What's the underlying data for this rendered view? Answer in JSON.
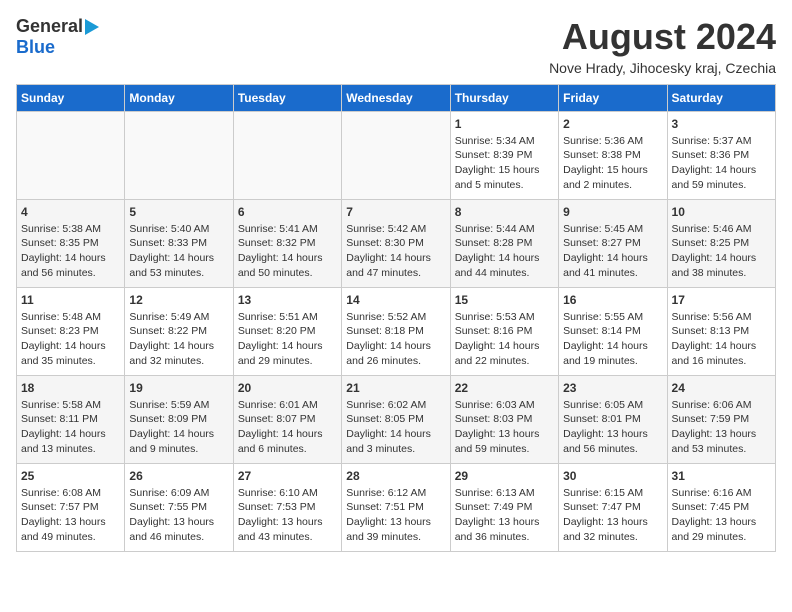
{
  "header": {
    "logo_general": "General",
    "logo_blue": "Blue",
    "month_year": "August 2024",
    "location": "Nove Hrady, Jihocesky kraj, Czechia"
  },
  "days_of_week": [
    "Sunday",
    "Monday",
    "Tuesday",
    "Wednesday",
    "Thursday",
    "Friday",
    "Saturday"
  ],
  "weeks": [
    [
      {
        "day": "",
        "info": ""
      },
      {
        "day": "",
        "info": ""
      },
      {
        "day": "",
        "info": ""
      },
      {
        "day": "",
        "info": ""
      },
      {
        "day": "1",
        "info": "Sunrise: 5:34 AM\nSunset: 8:39 PM\nDaylight: 15 hours\nand 5 minutes."
      },
      {
        "day": "2",
        "info": "Sunrise: 5:36 AM\nSunset: 8:38 PM\nDaylight: 15 hours\nand 2 minutes."
      },
      {
        "day": "3",
        "info": "Sunrise: 5:37 AM\nSunset: 8:36 PM\nDaylight: 14 hours\nand 59 minutes."
      }
    ],
    [
      {
        "day": "4",
        "info": "Sunrise: 5:38 AM\nSunset: 8:35 PM\nDaylight: 14 hours\nand 56 minutes."
      },
      {
        "day": "5",
        "info": "Sunrise: 5:40 AM\nSunset: 8:33 PM\nDaylight: 14 hours\nand 53 minutes."
      },
      {
        "day": "6",
        "info": "Sunrise: 5:41 AM\nSunset: 8:32 PM\nDaylight: 14 hours\nand 50 minutes."
      },
      {
        "day": "7",
        "info": "Sunrise: 5:42 AM\nSunset: 8:30 PM\nDaylight: 14 hours\nand 47 minutes."
      },
      {
        "day": "8",
        "info": "Sunrise: 5:44 AM\nSunset: 8:28 PM\nDaylight: 14 hours\nand 44 minutes."
      },
      {
        "day": "9",
        "info": "Sunrise: 5:45 AM\nSunset: 8:27 PM\nDaylight: 14 hours\nand 41 minutes."
      },
      {
        "day": "10",
        "info": "Sunrise: 5:46 AM\nSunset: 8:25 PM\nDaylight: 14 hours\nand 38 minutes."
      }
    ],
    [
      {
        "day": "11",
        "info": "Sunrise: 5:48 AM\nSunset: 8:23 PM\nDaylight: 14 hours\nand 35 minutes."
      },
      {
        "day": "12",
        "info": "Sunrise: 5:49 AM\nSunset: 8:22 PM\nDaylight: 14 hours\nand 32 minutes."
      },
      {
        "day": "13",
        "info": "Sunrise: 5:51 AM\nSunset: 8:20 PM\nDaylight: 14 hours\nand 29 minutes."
      },
      {
        "day": "14",
        "info": "Sunrise: 5:52 AM\nSunset: 8:18 PM\nDaylight: 14 hours\nand 26 minutes."
      },
      {
        "day": "15",
        "info": "Sunrise: 5:53 AM\nSunset: 8:16 PM\nDaylight: 14 hours\nand 22 minutes."
      },
      {
        "day": "16",
        "info": "Sunrise: 5:55 AM\nSunset: 8:14 PM\nDaylight: 14 hours\nand 19 minutes."
      },
      {
        "day": "17",
        "info": "Sunrise: 5:56 AM\nSunset: 8:13 PM\nDaylight: 14 hours\nand 16 minutes."
      }
    ],
    [
      {
        "day": "18",
        "info": "Sunrise: 5:58 AM\nSunset: 8:11 PM\nDaylight: 14 hours\nand 13 minutes."
      },
      {
        "day": "19",
        "info": "Sunrise: 5:59 AM\nSunset: 8:09 PM\nDaylight: 14 hours\nand 9 minutes."
      },
      {
        "day": "20",
        "info": "Sunrise: 6:01 AM\nSunset: 8:07 PM\nDaylight: 14 hours\nand 6 minutes."
      },
      {
        "day": "21",
        "info": "Sunrise: 6:02 AM\nSunset: 8:05 PM\nDaylight: 14 hours\nand 3 minutes."
      },
      {
        "day": "22",
        "info": "Sunrise: 6:03 AM\nSunset: 8:03 PM\nDaylight: 13 hours\nand 59 minutes."
      },
      {
        "day": "23",
        "info": "Sunrise: 6:05 AM\nSunset: 8:01 PM\nDaylight: 13 hours\nand 56 minutes."
      },
      {
        "day": "24",
        "info": "Sunrise: 6:06 AM\nSunset: 7:59 PM\nDaylight: 13 hours\nand 53 minutes."
      }
    ],
    [
      {
        "day": "25",
        "info": "Sunrise: 6:08 AM\nSunset: 7:57 PM\nDaylight: 13 hours\nand 49 minutes."
      },
      {
        "day": "26",
        "info": "Sunrise: 6:09 AM\nSunset: 7:55 PM\nDaylight: 13 hours\nand 46 minutes."
      },
      {
        "day": "27",
        "info": "Sunrise: 6:10 AM\nSunset: 7:53 PM\nDaylight: 13 hours\nand 43 minutes."
      },
      {
        "day": "28",
        "info": "Sunrise: 6:12 AM\nSunset: 7:51 PM\nDaylight: 13 hours\nand 39 minutes."
      },
      {
        "day": "29",
        "info": "Sunrise: 6:13 AM\nSunset: 7:49 PM\nDaylight: 13 hours\nand 36 minutes."
      },
      {
        "day": "30",
        "info": "Sunrise: 6:15 AM\nSunset: 7:47 PM\nDaylight: 13 hours\nand 32 minutes."
      },
      {
        "day": "31",
        "info": "Sunrise: 6:16 AM\nSunset: 7:45 PM\nDaylight: 13 hours\nand 29 minutes."
      }
    ]
  ]
}
